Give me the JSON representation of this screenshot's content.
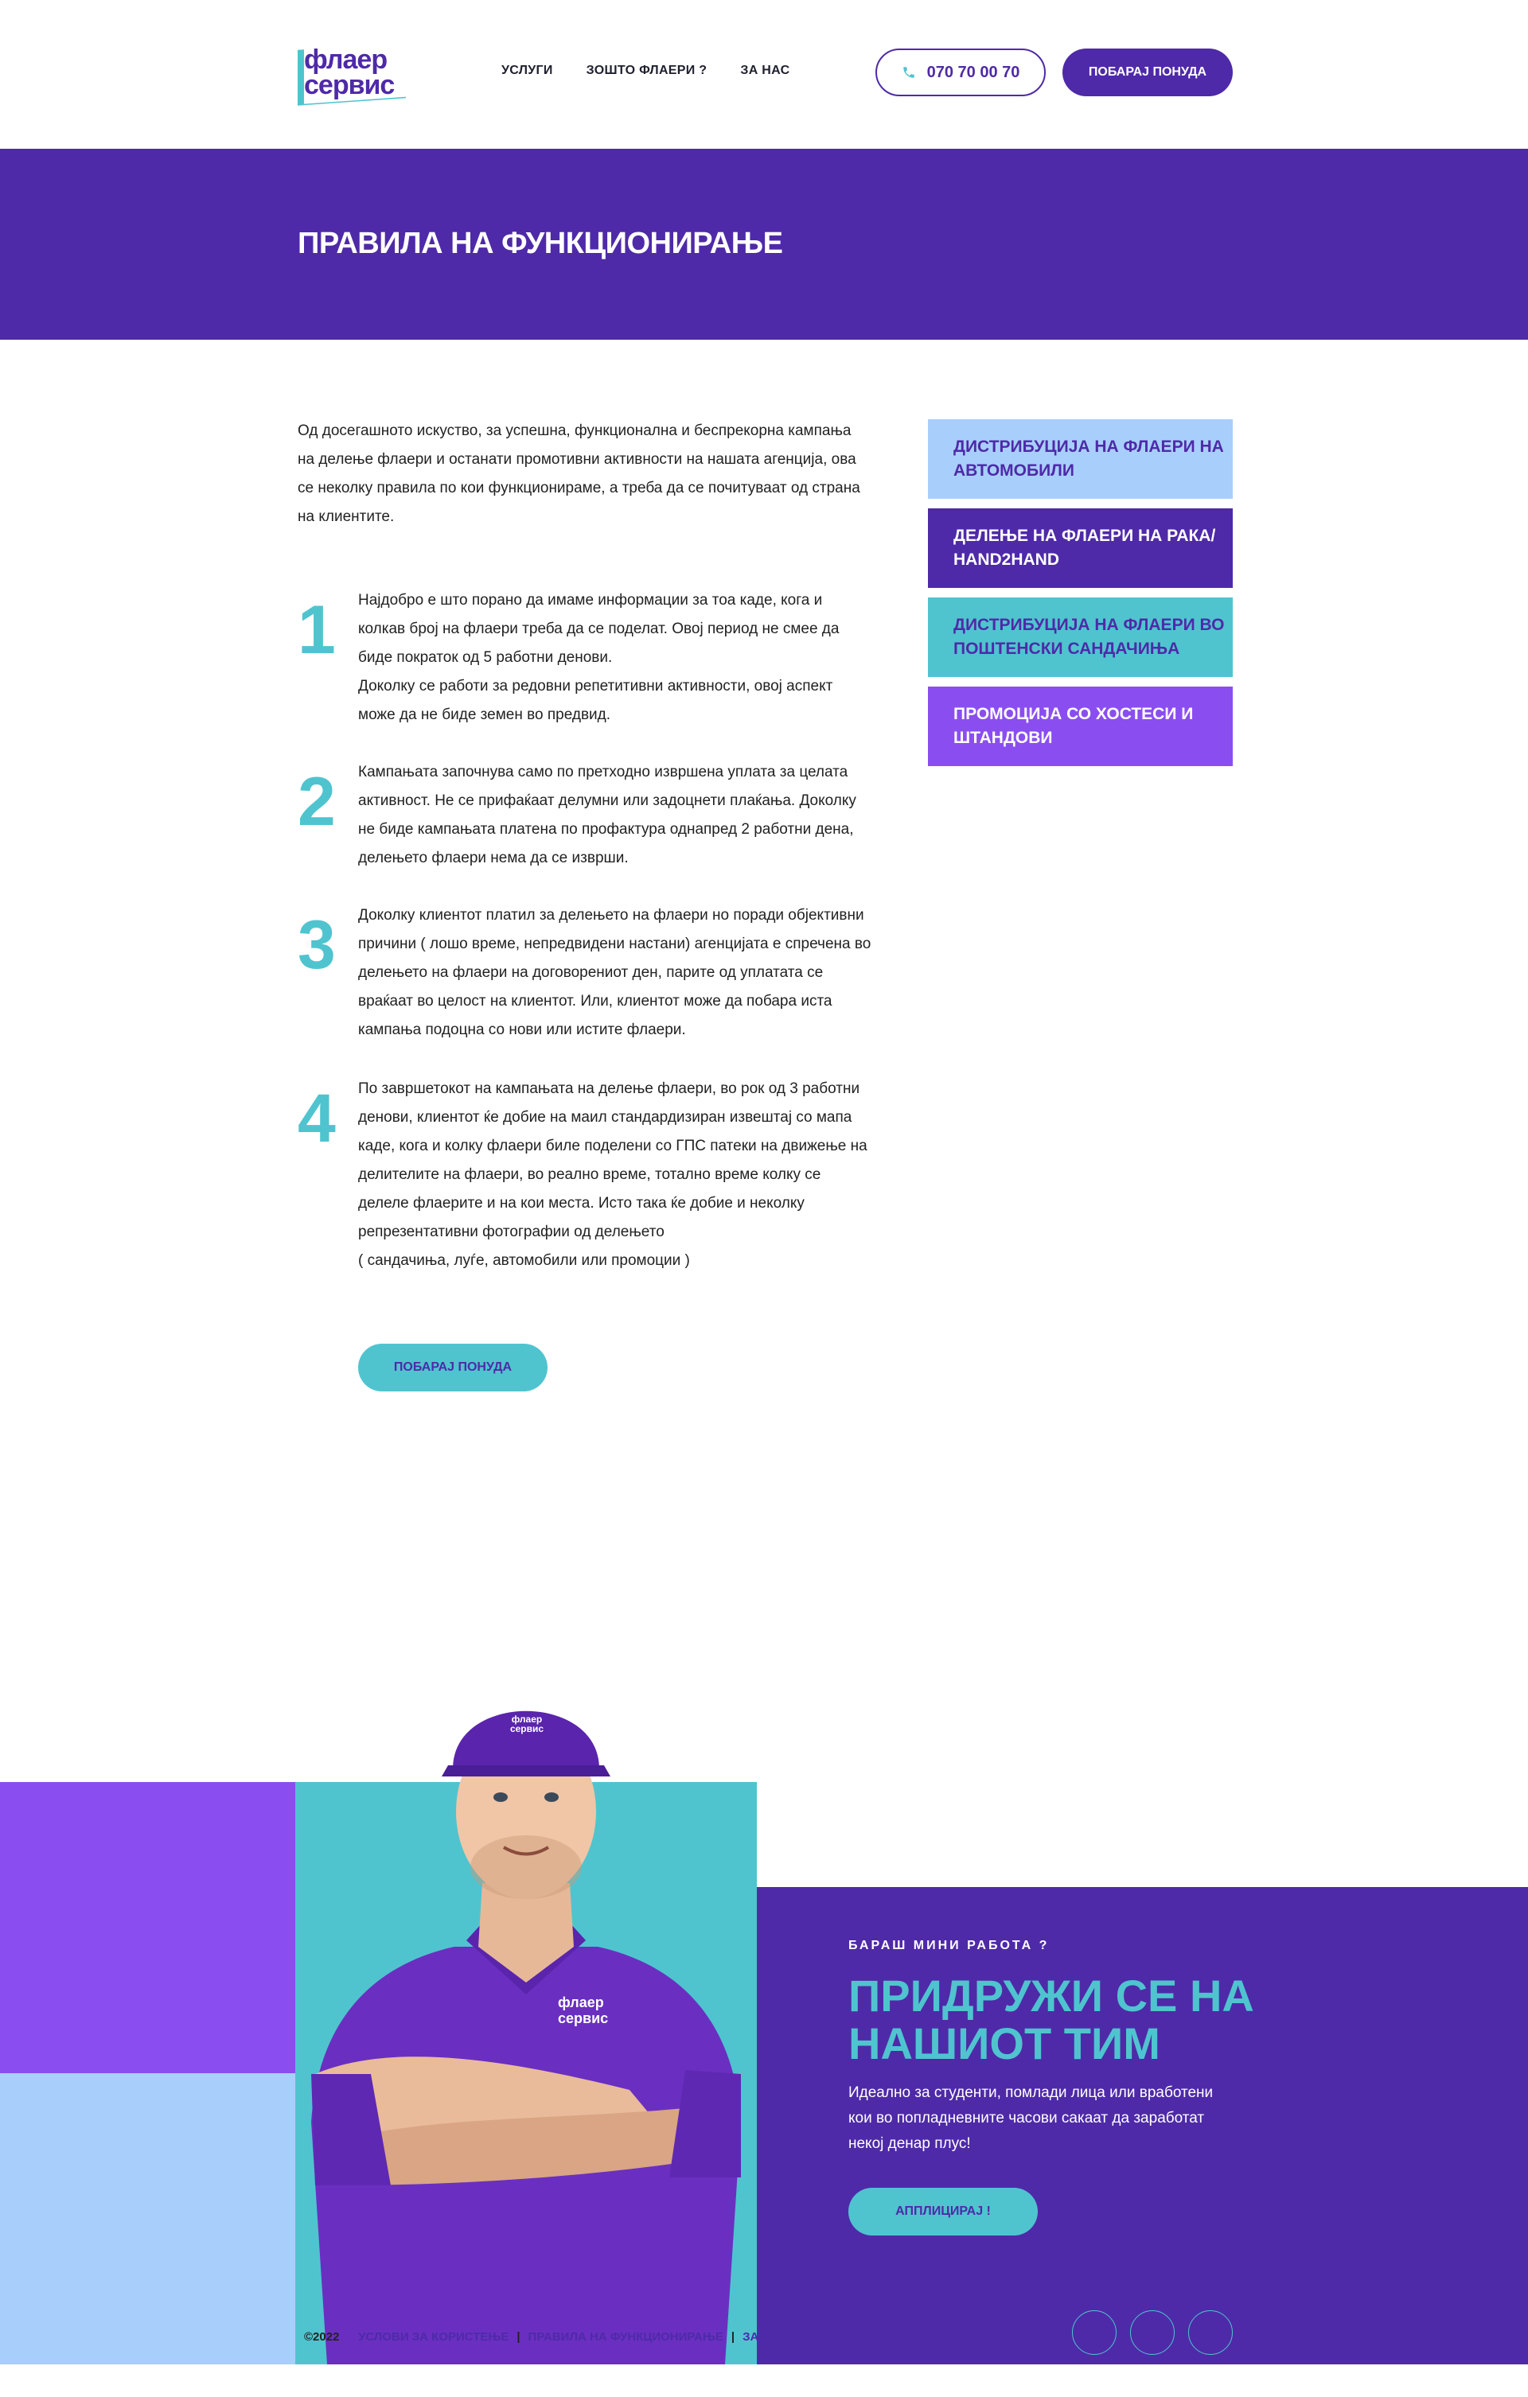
{
  "logo": {
    "line1": "флаер",
    "line2": "сервис"
  },
  "nav": [
    {
      "label": "УСЛУГИ"
    },
    {
      "label": "ЗОШТО ФЛАЕРИ ?"
    },
    {
      "label": "ЗА НАС"
    }
  ],
  "header": {
    "phone": "070 70 00 70",
    "quote_label": "ПОБАРАЈ ПОНУДА"
  },
  "hero": {
    "title": "ПРАВИЛА НА ФУНКЦИОНИРАЊЕ"
  },
  "intro": "Од досегашното искуство, за успешна, функционална и беспрекорна кампања на делење флаери и останати промотивни активности на нашата агенција, ова се неколку правила по кои функционираме, а треба да се почитуваат од страна на клиентите.",
  "rules": [
    {
      "num": "1",
      "text": "Најдобро е што порано да имаме информации за тоа каде, кога и колкав број на флаери треба да се поделат. Овој период не смее да биде пократок од 5 работни денови.\nДоколку се работи за редовни репетитивни активности, овој аспект може да не биде земен во предвид."
    },
    {
      "num": "2",
      "text": "Кампањата започнува само по претходно извршена уплата за целата активност. Не се прифаќаат делумни или задоцнети плаќања. Доколку не биде кампањата платена по профактура однапред 2 работни дена, делењето флаери нема да се изврши."
    },
    {
      "num": "3",
      "text": "Доколку клиентот платил за делењето на флаери но поради објективни причини ( лошо време, непредвидени настани) агенцијата е спречена во делењето на флаери на договорениот ден, парите од уплатата се враќаат во целост на клиентот. Или, клиентот може да побара иста кампања подоцна со нови или истите флаери."
    },
    {
      "num": "4",
      "text": "По завршетокот на кампањата на делење флаери, во рок од 3 работни денови, клиентот ќе добие на маил стандардизиран извештај со мапа каде, кога и колку флаери биле поделени со ГПС патеки на движење на делителите на флаери, во реално време, тотално време колку се делеле флаерите и на кои места. Исто така ќе добие и неколку репрезентативни фотографии од делењето\n( сандачиња, луѓе, автомобили или промоции )"
    }
  ],
  "rules_button": "ПОБАРАЈ ПОНУДА",
  "sidebar": [
    {
      "label": "ДИСТРИБУЦИЈА НА ФЛАЕРИ НА АВТОМОБИЛИ",
      "bg": "#a8cffc",
      "color": "#4e2aa8"
    },
    {
      "label": "ДЕЛЕЊЕ НА ФЛАЕРИ НА РАКА/ HAND2HAND",
      "bg": "#4e2aa8",
      "color": "#ffffff"
    },
    {
      "label": "ДИСТРИБУЦИЈА НА ФЛАЕРИ ВО ПОШТЕНСКИ САНДАЧИЊА",
      "bg": "#4fc4cf",
      "color": "#4e2aa8"
    },
    {
      "label": "ПРОМОЦИЈА СО ХОСТЕСИ И ШТАНДОВИ",
      "bg": "#8a4ef0",
      "color": "#ffffff"
    }
  ],
  "team": {
    "subtitle": "БАРАШ МИНИ РАБОТА ?",
    "heading": "ПРИДРУЖИ СЕ НА НАШИОТ ТИМ",
    "text": "Идеално за студенти, помлади лица или вработени кои во попладневните часови сакаат да заработат некој денар плус!",
    "button": "АППЛИЦИРАЈ !",
    "cap_logo": "флаер сервис",
    "shirt_logo": "флаер сервис"
  },
  "footer": {
    "copyright": "©2022",
    "links": [
      "УСЛОВИ ЗА КОРИСТЕЊЕ",
      "ПРАВИЛА НА ФУНКЦИОНИРАЊЕ",
      "ЗА НАС"
    ],
    "social": [
      "facebook-icon",
      "instagram-icon",
      "linkedin-icon"
    ]
  },
  "colors": {
    "dark_purple": "#4e2aa8",
    "teal": "#4fc4cf",
    "light_blue": "#a8cffc",
    "violet": "#8a4ef0"
  }
}
